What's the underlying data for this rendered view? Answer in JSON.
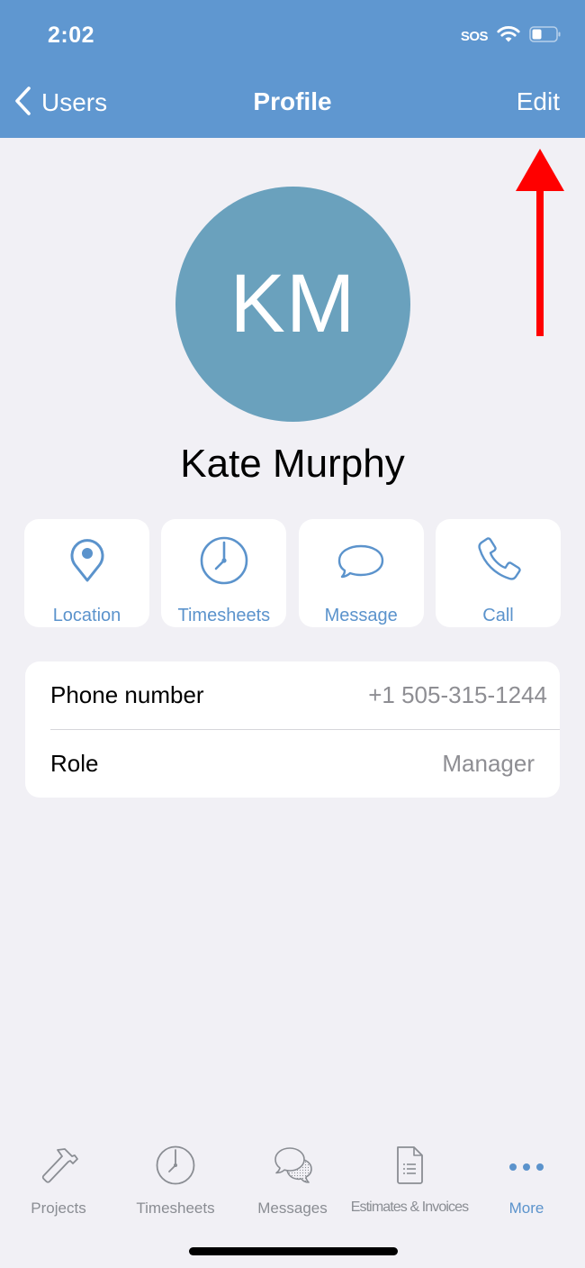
{
  "status_bar": {
    "time": "2:02",
    "carrier": "SOS",
    "wifi_icon": "wifi-icon",
    "battery_icon": "battery-icon",
    "battery_level_percent": 35
  },
  "nav": {
    "back_label": "Users",
    "back_icon": "chevron-left-icon",
    "title": "Profile",
    "edit_label": "Edit"
  },
  "profile": {
    "initials": "KM",
    "name": "Kate Murphy",
    "avatar_color": "#6aa1bd"
  },
  "actions": [
    {
      "label": "Location",
      "icon": "location-pin-icon"
    },
    {
      "label": "Timesheets",
      "icon": "clock-icon"
    },
    {
      "label": "Message",
      "icon": "speech-bubble-icon"
    },
    {
      "label": "Call",
      "icon": "phone-icon"
    }
  ],
  "details": [
    {
      "label": "Phone number",
      "value": "+1 505-315-1244"
    },
    {
      "label": "Role",
      "value": "Manager"
    }
  ],
  "tabbar": {
    "items": [
      {
        "label": "Projects",
        "icon": "hammer-icon",
        "active": false
      },
      {
        "label": "Timesheets",
        "icon": "clock-icon",
        "active": false
      },
      {
        "label": "Messages",
        "icon": "chat-bubbles-icon",
        "active": false
      },
      {
        "label": "Estimates & Invoices",
        "icon": "document-icon",
        "active": false
      },
      {
        "label": "More",
        "icon": "more-dots-icon",
        "active": true
      }
    ]
  },
  "annotation": {
    "type": "red-arrow",
    "points_to": "Edit"
  },
  "colors": {
    "header": "#5f97d0",
    "accent": "#5b93cc",
    "background": "#f1f0f5",
    "secondary_text": "#8e8e93",
    "annotation": "#ff0000"
  }
}
